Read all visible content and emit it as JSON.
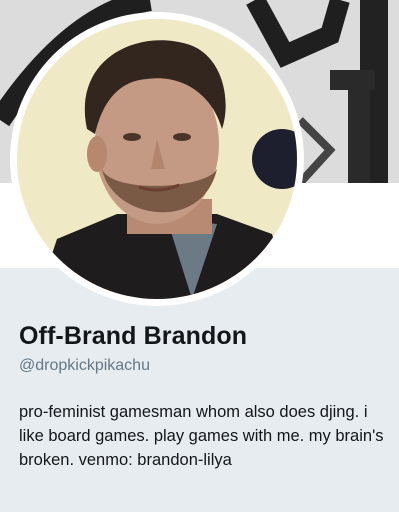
{
  "profile": {
    "display_name": "Off-Brand Brandon",
    "handle": "@dropkickpikachu",
    "bio": "pro-feminist gamesman whom also does djing. i like board games. play games with me. my brain's broken. venmo: brandon-lilya"
  },
  "colors": {
    "background": "#e6ecf0",
    "name_text": "#14171a",
    "handle_text": "#657786",
    "avatar_border": "#ffffff"
  }
}
